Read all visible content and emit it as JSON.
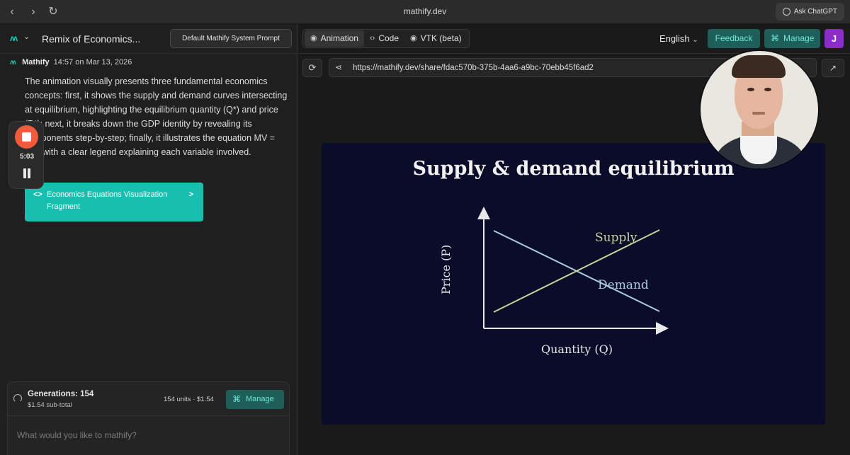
{
  "browser": {
    "title": "mathify.dev",
    "back_icon": "chevron-left-icon",
    "forward_icon": "chevron-right-icon",
    "reload_icon": "reload-icon",
    "ask_label": "Ask ChatGPT"
  },
  "left": {
    "project_title": "Remix of Economics...",
    "system_prompt_label": "Default Mathify System Prompt",
    "message": {
      "author": "Mathify",
      "timestamp": "14:57 on Mar 13, 2026",
      "text": "The animation visually presents three fundamental economics concepts: first, it shows the supply and demand curves intersecting at equilibrium, highlighting the equilibrium quantity (Q*) and price (P*); next, it breaks down the GDP identity by revealing its components step-by-step; finally, it illustrates the equation MV = PQ, with a clear legend explaining each variable involved."
    },
    "fragment": {
      "lead": "<>",
      "label": "Economics Equations Visualization Fragment",
      "arrow": ">"
    },
    "recorder": {
      "time": "5:03"
    },
    "generations": {
      "count_label": "Generations: 154",
      "subtotal": "$1.54 sub-total",
      "units": "154 units · $1.54",
      "manage_label": "Manage"
    },
    "prompt": {
      "placeholder": "What would you like to mathify?"
    }
  },
  "right": {
    "tabs": [
      {
        "label": "Animation",
        "icon": "eye-icon",
        "active": true
      },
      {
        "label": "Code",
        "icon": "code-icon",
        "active": false
      },
      {
        "label": "VTK (beta)",
        "icon": "eye-icon",
        "active": false
      }
    ],
    "language": "English",
    "feedback_label": "Feedback",
    "manage_label": "Manage",
    "avatar_letter": "J",
    "url": "https://mathify.dev/share/fdac570b-375b-4aa6-a9bc-70ebb45f6ad2",
    "colors": {
      "accent": "#17bfae",
      "stage_bg": "#0b0c2a",
      "supply": "#c6d49a",
      "demand": "#a9cde0"
    }
  },
  "animation": {
    "title": "Supply & demand equilibrium",
    "y_label": "Price (P)",
    "x_label": "Quantity (Q)",
    "supply_label": "Supply",
    "demand_label": "Demand"
  }
}
